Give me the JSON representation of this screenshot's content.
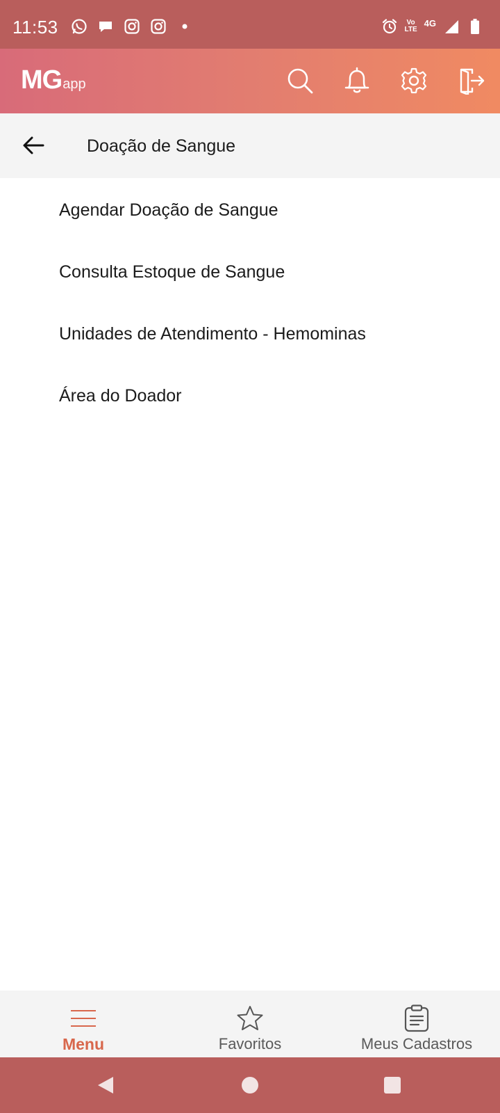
{
  "status_bar": {
    "time": "11:53",
    "left_icons": [
      "whatsapp-icon",
      "chat-bubble-icon",
      "instagram-icon",
      "instagram-icon",
      "dot-icon"
    ],
    "volte_line1": "Vo",
    "volte_line2": "LTE",
    "network": "4G"
  },
  "app_bar": {
    "logo_main": "MG",
    "logo_sub": "app",
    "actions": [
      "search-icon",
      "bell-icon",
      "gear-icon",
      "logout-icon"
    ]
  },
  "page": {
    "title": "Doação de Sangue"
  },
  "menu": {
    "items": [
      {
        "label": "Agendar Doação de Sangue"
      },
      {
        "label": "Consulta Estoque de Sangue"
      },
      {
        "label": "Unidades de Atendimento - Hemominas"
      },
      {
        "label": "Área do Doador"
      }
    ]
  },
  "bottom_nav": {
    "items": [
      {
        "label": "Menu",
        "icon": "hamburger-icon",
        "active": true
      },
      {
        "label": "Favoritos",
        "icon": "star-icon",
        "active": false
      },
      {
        "label": "Meus Cadastros",
        "icon": "clipboard-icon",
        "active": false
      }
    ]
  },
  "colors": {
    "status_bar": "#b95e5c",
    "gradient_start": "#d86b79",
    "gradient_end": "#f08a62",
    "active_accent": "#d8674c"
  }
}
